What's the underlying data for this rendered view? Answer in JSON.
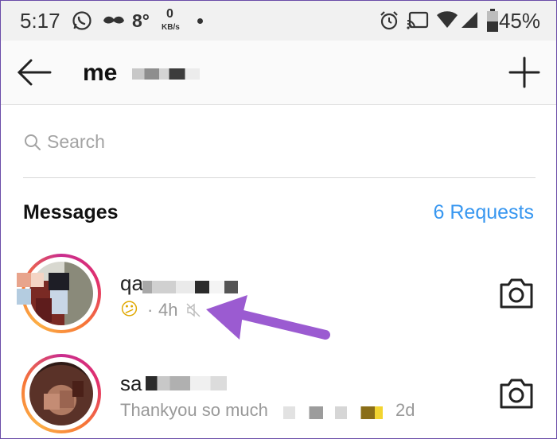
{
  "status_bar": {
    "time": "5:17",
    "temperature": "8°",
    "network_speed_value": "0",
    "network_speed_unit": "KB/s",
    "battery_percent": "45%",
    "icons": [
      "whatsapp-icon",
      "mustache-icon",
      "dot-icon",
      "alarm-icon",
      "cast-icon",
      "wifi-icon",
      "signal-icon",
      "battery-icon"
    ]
  },
  "header": {
    "title": "me",
    "back_icon": "arrow-left-icon",
    "new_message_icon": "plus-icon"
  },
  "search": {
    "placeholder": "Search"
  },
  "messages": {
    "heading": "Messages",
    "requests_label": "6 Requests",
    "accent_color": "#3897f0"
  },
  "conversations": [
    {
      "name": "qa",
      "emoji": "😕",
      "time": "4h",
      "muted": true,
      "action_icon": "camera-icon"
    },
    {
      "name": "sa",
      "preview": "Thankyou so much",
      "time": "2d",
      "action_icon": "camera-icon"
    }
  ],
  "annotation": {
    "arrow_color": "#9b5bd1"
  }
}
